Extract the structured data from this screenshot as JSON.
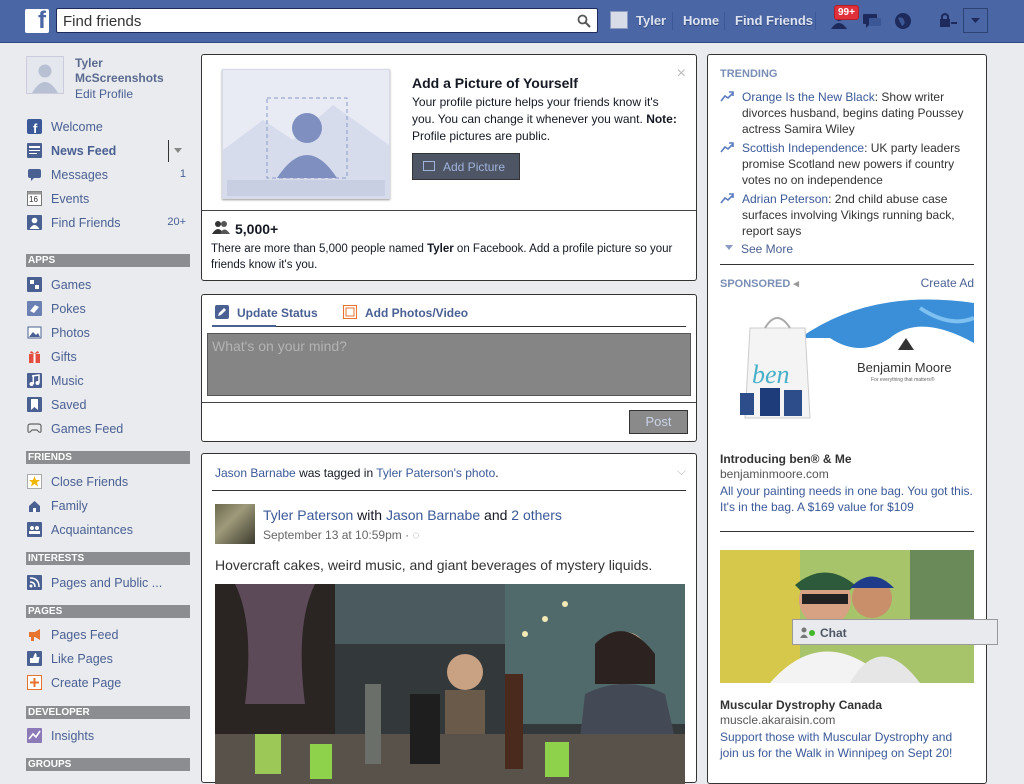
{
  "topbar": {
    "logo": "f",
    "search_placeholder": "Find friends",
    "user_name": "Tyler",
    "nav_home": "Home",
    "nav_find_friends": "Find Friends",
    "notifications_count": "99+"
  },
  "profile": {
    "name": "Tyler McScreenshots",
    "edit_label": "Edit Profile"
  },
  "left_nav": {
    "main": [
      {
        "label": "Welcome",
        "icon": "facebook-icon",
        "count": ""
      },
      {
        "label": "News Feed",
        "icon": "news-feed-icon",
        "count": ""
      },
      {
        "label": "Messages",
        "icon": "messages-icon",
        "count": "1"
      },
      {
        "label": "Events",
        "icon": "calendar-icon",
        "count": "",
        "calendar_day": "16"
      },
      {
        "label": "Find Friends",
        "icon": "find-friends-icon",
        "count": "20+"
      }
    ],
    "apps_header": "APPS",
    "apps": [
      {
        "label": "Games",
        "icon": "games-icon"
      },
      {
        "label": "Pokes",
        "icon": "pokes-icon"
      },
      {
        "label": "Photos",
        "icon": "photos-icon"
      },
      {
        "label": "Gifts",
        "icon": "gift-icon"
      },
      {
        "label": "Music",
        "icon": "music-icon"
      },
      {
        "label": "Saved",
        "icon": "saved-icon"
      },
      {
        "label": "Games Feed",
        "icon": "gamepad-icon"
      }
    ],
    "friends_header": "FRIENDS",
    "friends": [
      {
        "label": "Close Friends",
        "icon": "star-icon"
      },
      {
        "label": "Family",
        "icon": "family-icon"
      },
      {
        "label": "Acquaintances",
        "icon": "acquaintances-icon"
      }
    ],
    "interests_header": "INTERESTS",
    "interests": [
      {
        "label": "Pages and Public ...",
        "icon": "rss-icon"
      }
    ],
    "pages_header": "PAGES",
    "pages": [
      {
        "label": "Pages Feed",
        "icon": "megaphone-icon"
      },
      {
        "label": "Like Pages",
        "icon": "thumbs-up-icon"
      },
      {
        "label": "Create Page",
        "icon": "create-page-icon"
      }
    ],
    "developer_header": "DEVELOPER",
    "developer": [
      {
        "label": "Insights",
        "icon": "insights-icon"
      }
    ],
    "groups_header": "GROUPS"
  },
  "add_picture": {
    "title": "Add a Picture of Yourself",
    "text": "Your profile picture helps your friends know it's you. You can change it whenever you want.",
    "note_label": "Note:",
    "note_text": " Profile pictures are public.",
    "button_label": "Add Picture",
    "close_label": "×",
    "people_count": "5,000+",
    "people_text_before": "There are more than 5,000 people named ",
    "people_name": "Tyler",
    "people_text_after": " on Facebook. Add a profile picture so your friends know it's you."
  },
  "composer": {
    "tab_status": "Update Status",
    "tab_photos": "Add Photos/Video",
    "placeholder": "What's on your mind?",
    "post_label": "Post"
  },
  "story": {
    "context_person": "Jason Barnabe",
    "context_middle": " was tagged in ",
    "context_owner": "Tyler Paterson's photo",
    "context_end": ".",
    "actor": "Tyler Paterson",
    "with_label": " with ",
    "tagged": "Jason Barnabe",
    "and_label": " and ",
    "others": "2 others",
    "time": "September 13 at 10:59pm · ",
    "text": "Hovercraft cakes, weird music, and giant beverages of mystery liquids."
  },
  "trending": {
    "header": "TRENDING",
    "items": [
      {
        "topic": "Orange Is the New Black",
        "desc": ": Show writer divorces husband, begins dating Poussey actress Samira Wiley"
      },
      {
        "topic": "Scottish Independence",
        "desc": ": UK party leaders promise Scotland new powers if country votes no on independence"
      },
      {
        "topic": "Adrian Peterson",
        "desc": ": 2nd child abuse case surfaces involving Vikings running back, report says"
      }
    ],
    "see_more": "See More"
  },
  "sponsored": {
    "header": "SPONSORED",
    "create_ad": "Create Ad",
    "ads": [
      {
        "title": "Introducing ben® & Me",
        "url": "benjaminmoore.com",
        "text": "All your painting needs in one bag. You got this. It's in the bag. A $169 value for $109",
        "brand": "Benjamin Moore",
        "tagline": "For everything that matters®",
        "bag_text": "ben"
      },
      {
        "title": "Muscular Dystrophy Canada",
        "url": "muscle.akaraisin.com",
        "text": "Support those with Muscular Dystrophy and join us for the Walk in Winnipeg on Sept 20!"
      }
    ]
  },
  "chat": {
    "label": "Chat"
  },
  "colors": {
    "topbar": "#4a66a5",
    "link": "#3b5998",
    "badge": "#e0303a"
  }
}
